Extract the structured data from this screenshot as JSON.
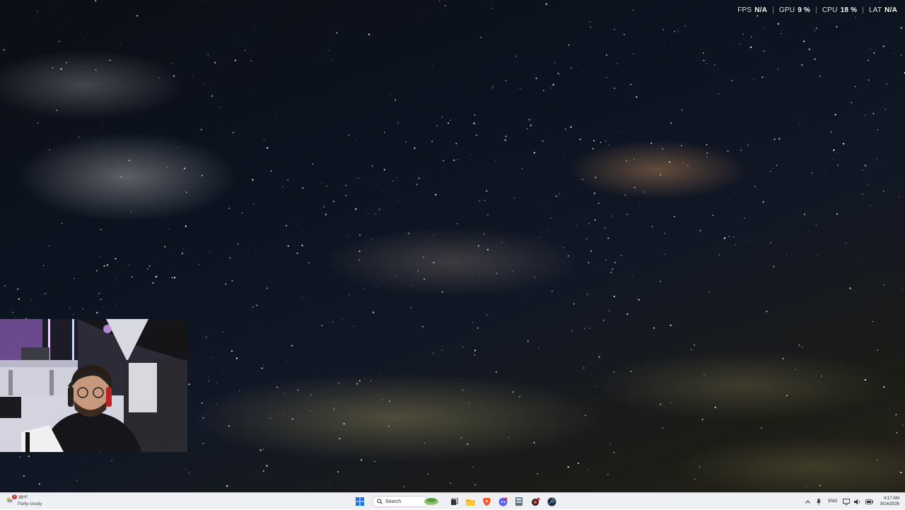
{
  "perf_overlay": {
    "fps_label": "FPS",
    "fps_value": "N/A",
    "gpu_label": "GPU",
    "gpu_value": "9 %",
    "cpu_label": "CPU",
    "cpu_value": "18 %",
    "lat_label": "LAT",
    "lat_value": "N/A",
    "separator": "|"
  },
  "taskbar": {
    "weather": {
      "temp": "39°F",
      "condition": "Partly cloudy",
      "badge": "1",
      "icon": "cloud-moon-icon"
    },
    "start_icon": "windows-start-icon",
    "search_placeholder": "Search",
    "apps": [
      {
        "name": "task-view-icon"
      },
      {
        "name": "file-explorer-icon"
      },
      {
        "name": "brave-browser-icon"
      },
      {
        "name": "discord-icon"
      },
      {
        "name": "calculator-icon"
      },
      {
        "name": "game-app-icon"
      },
      {
        "name": "steam-icon"
      }
    ],
    "tray": {
      "chevron_icon": "chevron-up-icon",
      "mic_icon": "microphone-icon",
      "language": "ENG",
      "network_icon": "monitor-network-icon",
      "volume_icon": "speaker-icon",
      "battery_icon": "battery-icon"
    },
    "clock": {
      "time": "4:17 AM",
      "date": "8/14/2026"
    }
  },
  "colors": {
    "taskbar_bg": "#eef0f3",
    "overlay_text": "#ffffff",
    "badge_red": "#d13438"
  }
}
